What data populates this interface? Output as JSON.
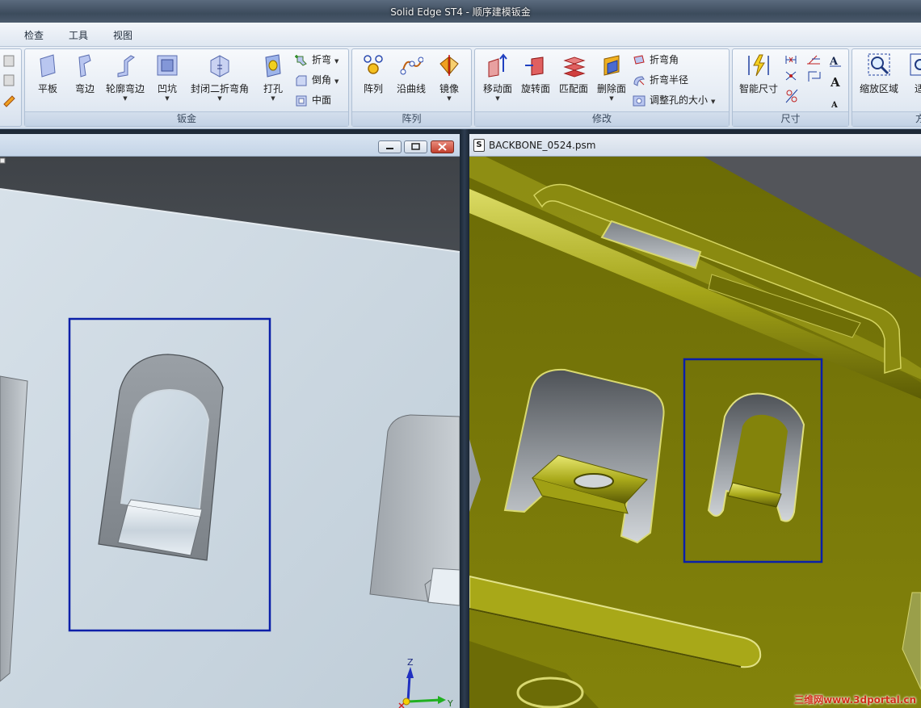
{
  "app": {
    "title": "Solid Edge ST4 - 顺序建模钣金"
  },
  "menu": {
    "tabs": [
      "检查",
      "工具",
      "视图"
    ]
  },
  "ribbon": {
    "sheetmetal": {
      "title": "钣金",
      "buttons": [
        "平板",
        "弯边",
        "轮廓弯边",
        "凹坑",
        "封闭二折弯角",
        "打孔"
      ],
      "small": [
        "折弯",
        "倒角",
        "中面"
      ]
    },
    "pattern": {
      "title": "阵列",
      "buttons": [
        "阵列",
        "沿曲线",
        "镜像"
      ]
    },
    "modify": {
      "title": "修改",
      "buttons": [
        "移动面",
        "旋转面",
        "匹配面",
        "删除面"
      ],
      "small": [
        "折弯角",
        "折弯半径",
        "调整孔的大小"
      ]
    },
    "dimension": {
      "title": "尺寸",
      "buttons": [
        "智能尺寸"
      ]
    },
    "view": {
      "title": "方",
      "buttons": [
        "缩放区域",
        "适"
      ]
    }
  },
  "left_window": {
    "axes": {
      "z": "Z",
      "y": "Y"
    }
  },
  "right_window": {
    "title": "BACKBONE_0524.psm"
  },
  "colors": {
    "selection": "#0a1fa8",
    "sheet_metal_yellow": "#7f7f08",
    "left_background": "#c5d2dc"
  },
  "watermark": "三维网www.3dportal.cn"
}
